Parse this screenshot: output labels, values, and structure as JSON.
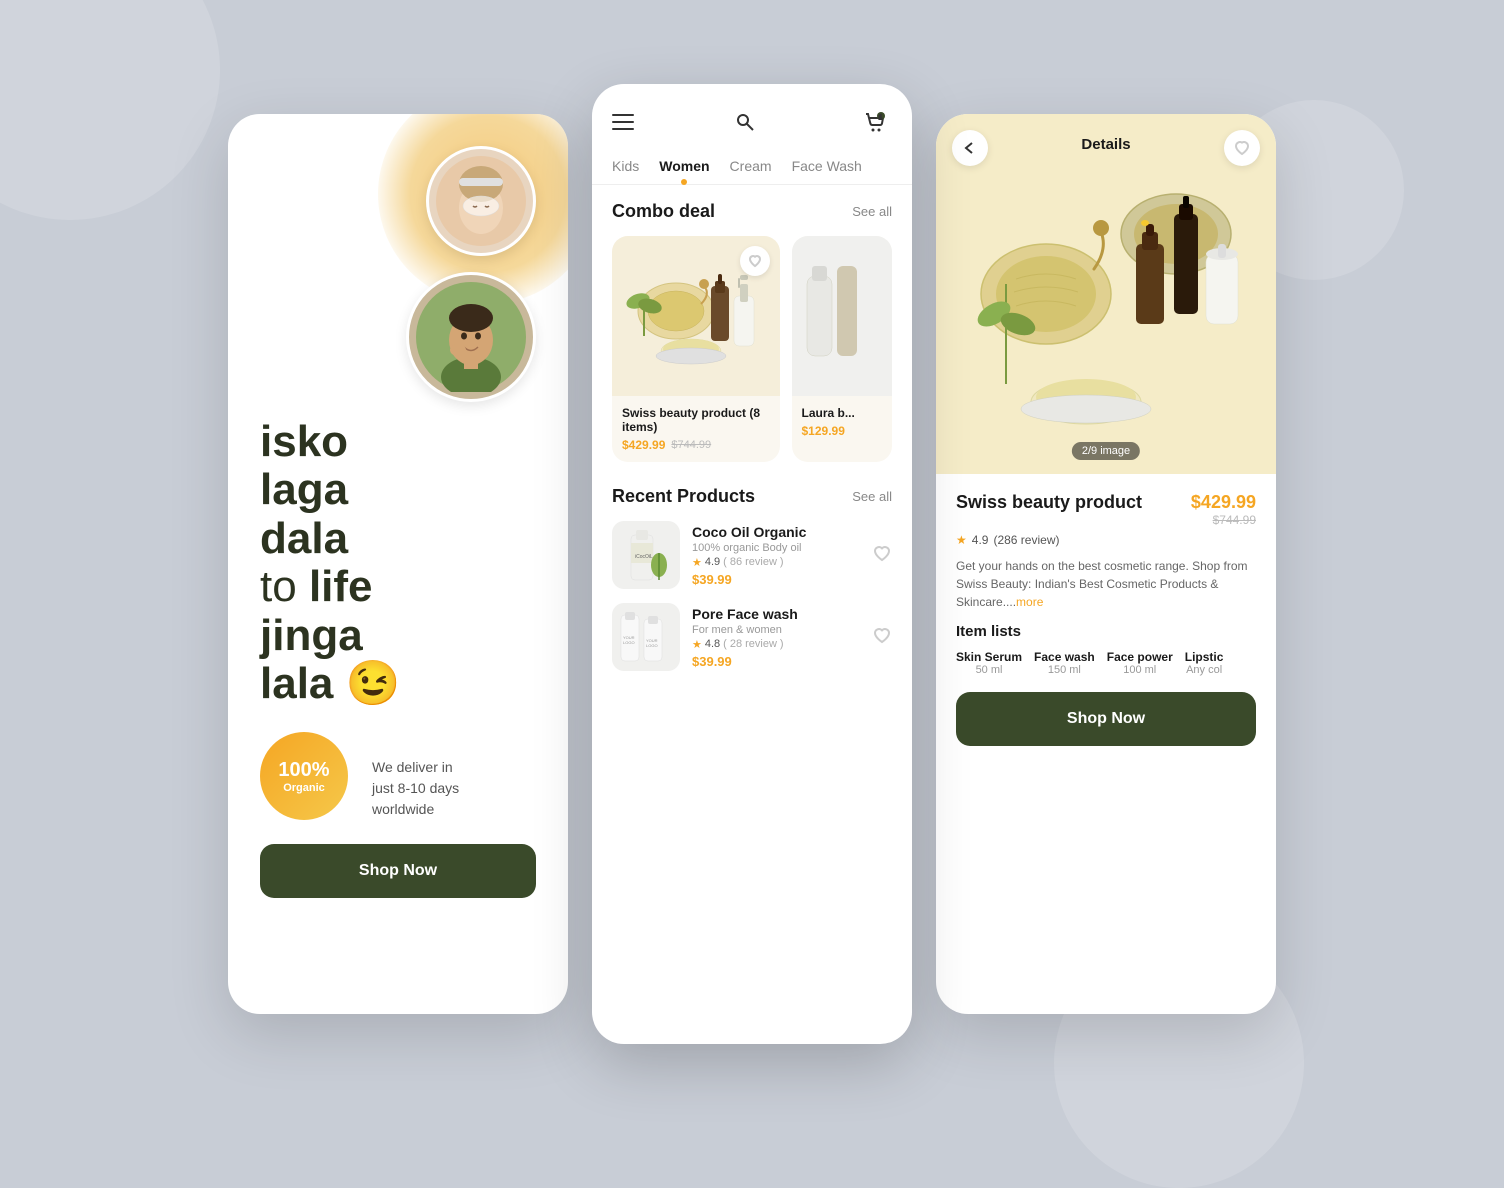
{
  "background": "#c8cdd6",
  "phone1": {
    "headline_line1": "isko",
    "headline_line2": "laga",
    "headline_line3": "dala",
    "headline_line4_light": "to",
    "headline_line4_bold": "life",
    "headline_line5": "jinga",
    "headline_line6": "lala",
    "emoji": "😉",
    "badge_percent": "100%",
    "badge_label": "Organic",
    "deliver_text": "We deliver in\njust 8-10 days\nworldwide",
    "btn_label": "Shop Now"
  },
  "phone2": {
    "tabs": [
      {
        "label": "Kids",
        "active": false
      },
      {
        "label": "Women",
        "active": true
      },
      {
        "label": "Cream",
        "active": false
      },
      {
        "label": "Face Wash",
        "active": false
      }
    ],
    "combo_section": {
      "title": "Combo deal",
      "see_all": "See all",
      "cards": [
        {
          "name": "Swiss beauty product (8 items)",
          "price_new": "$429.99",
          "price_old": "$744.99"
        },
        {
          "name": "Laura b...",
          "price_new": "$129.99",
          "price_old": "$..."
        }
      ]
    },
    "recent_section": {
      "title": "Recent Products",
      "see_all": "See all",
      "items": [
        {
          "name": "Coco Oil Organic",
          "sub": "100% organic Body oil",
          "rating": "4.9",
          "reviews": "86 review",
          "price": "$39.99"
        },
        {
          "name": "Pore Face wash",
          "sub": "For men & women",
          "rating": "4.8",
          "reviews": "28 review",
          "price": "$39.99"
        }
      ]
    }
  },
  "phone3": {
    "nav_title": "Details",
    "hero_counter": "2/9 image",
    "product_name": "Swiss beauty product",
    "price_new": "$429.99",
    "price_old": "$744.99",
    "rating": "4.9",
    "reviews": "286 review",
    "description": "Get your hands on the best cosmetic range. Shop from Swiss Beauty: Indian's Best Cosmetic Products & Skincare....",
    "more_label": "more",
    "items_title": "Item lists",
    "items": [
      {
        "name": "Skin Serum",
        "ml": "50 ml"
      },
      {
        "name": "Face wash",
        "ml": "150 ml"
      },
      {
        "name": "Face power",
        "ml": "100 ml"
      },
      {
        "name": "Lipstic",
        "ml": "Any col"
      }
    ],
    "btn_label": "Shop Now"
  }
}
